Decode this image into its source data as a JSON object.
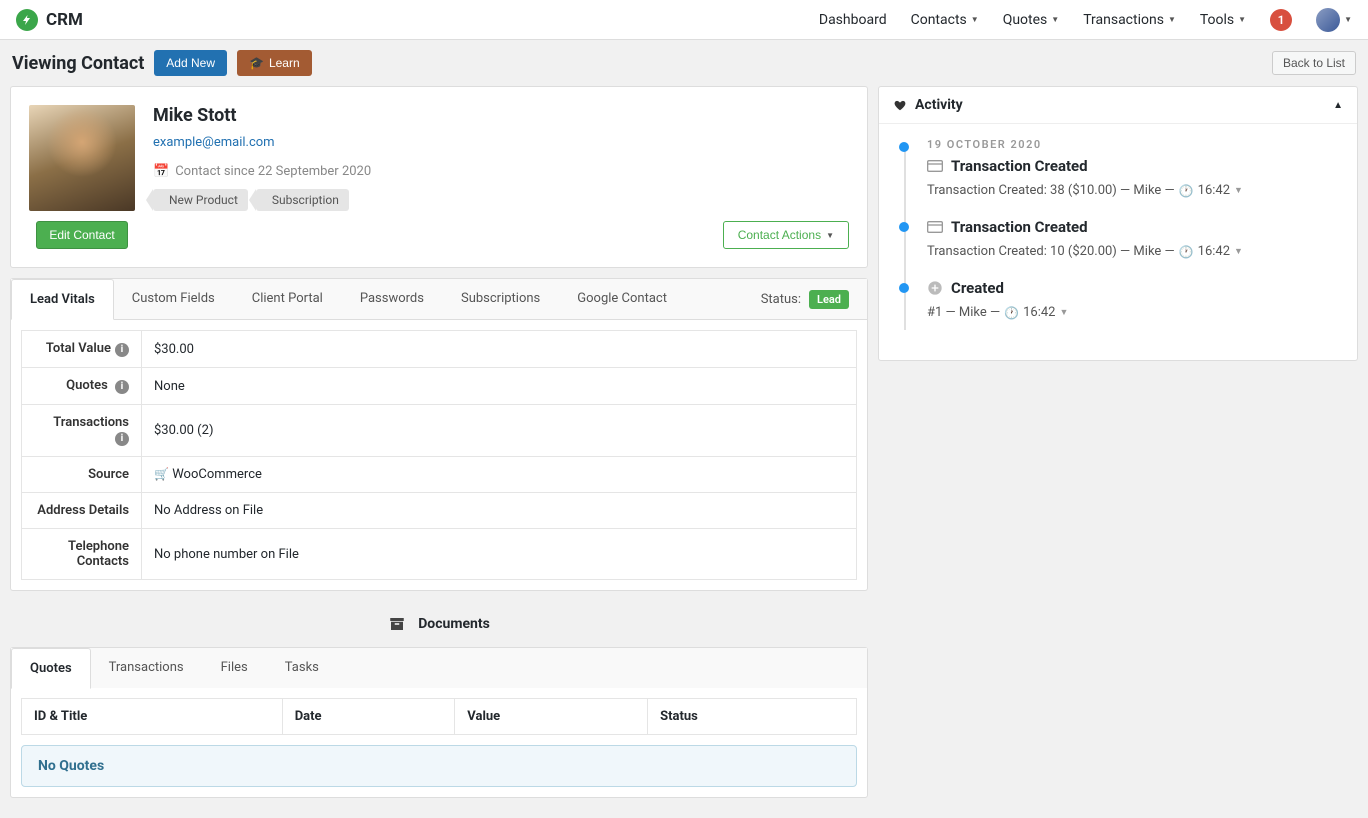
{
  "brand": "CRM",
  "nav": {
    "dashboard": "Dashboard",
    "contacts": "Contacts",
    "quotes": "Quotes",
    "transactions": "Transactions",
    "tools": "Tools",
    "notif_count": "1"
  },
  "header": {
    "title": "Viewing Contact",
    "add_new": "Add New",
    "learn": "Learn",
    "back": "Back to List"
  },
  "contact": {
    "name": "Mike Stott",
    "email": "example@email.com",
    "since": "Contact since 22 September 2020",
    "tags": [
      "New Product",
      "Subscription"
    ],
    "edit": "Edit Contact",
    "actions": "Contact Actions"
  },
  "tabs": {
    "lead_vitals": "Lead Vitals",
    "custom_fields": "Custom Fields",
    "client_portal": "Client Portal",
    "passwords": "Passwords",
    "subscriptions": "Subscriptions",
    "google_contact": "Google Contact",
    "status_label": "Status:",
    "status_value": "Lead"
  },
  "vitals": {
    "total_value_label": "Total Value",
    "total_value": "$30.00",
    "quotes_label": "Quotes",
    "quotes": "None",
    "transactions_label": "Transactions",
    "transactions": "$30.00 (2)",
    "source_label": "Source",
    "source": "WooCommerce",
    "address_label": "Address Details",
    "address": "No Address on File",
    "phone_label": "Telephone Contacts",
    "phone": "No phone number on File"
  },
  "documents": {
    "title": "Documents",
    "tabs": {
      "quotes": "Quotes",
      "transactions": "Transactions",
      "files": "Files",
      "tasks": "Tasks"
    },
    "cols": {
      "id": "ID & Title",
      "date": "Date",
      "value": "Value",
      "status": "Status"
    },
    "no_quotes": "No Quotes"
  },
  "activity": {
    "title": "Activity",
    "date": "19 OCTOBER 2020",
    "items": [
      {
        "title": "Transaction Created",
        "desc_prefix": "Transaction Created: 38 ($10.00) — Mike —",
        "time": "16:42"
      },
      {
        "title": "Transaction Created",
        "desc_prefix": "Transaction Created: 10 ($20.00) — Mike —",
        "time": "16:42"
      },
      {
        "title": "Created",
        "desc_prefix": "#1 — Mike —",
        "time": "16:42"
      }
    ]
  }
}
